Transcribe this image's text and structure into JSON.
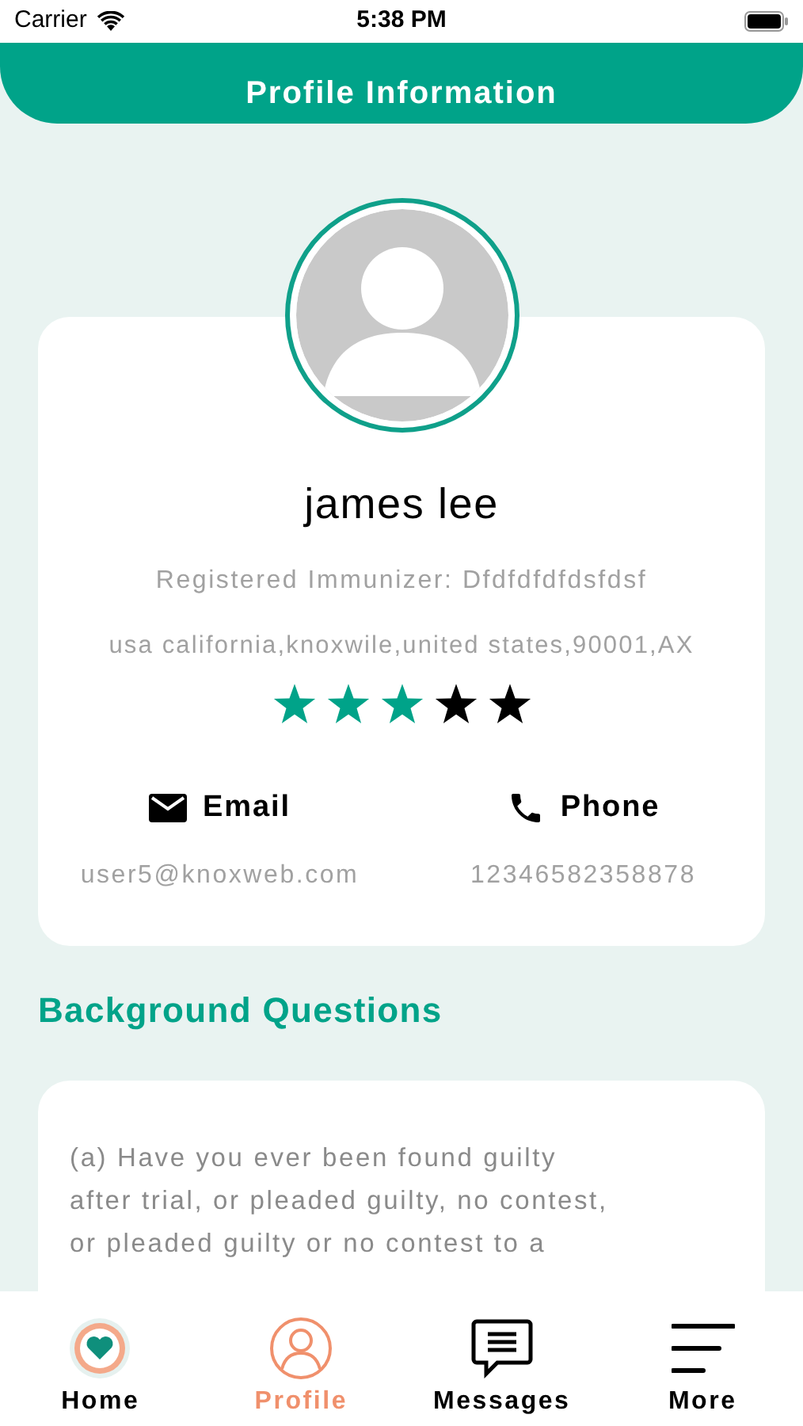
{
  "status_bar": {
    "carrier": "Carrier",
    "time": "5:38 PM"
  },
  "header": {
    "title": "Profile Information"
  },
  "profile": {
    "name": "james lee",
    "role": "Registered Immunizer: Dfdfdfdfdsfdsf",
    "address": "usa california,knoxwile,united states,90001,AX",
    "stars": 3,
    "contacts": [
      {
        "kind": "email",
        "label": "Email",
        "value": "user5@knoxweb.com"
      },
      {
        "kind": "phone",
        "label": "Phone",
        "value": "12346582358878"
      }
    ]
  },
  "background": {
    "title": "Background Questions",
    "questions": [
      "(a) Have you ever been found guilty\nafter trial, or pleaded guilty, no contest,\nor pleaded guilty or no contest to a"
    ]
  },
  "tab_bar": [
    {
      "kind": "home",
      "label": "Home",
      "selected": false
    },
    {
      "kind": "profile",
      "label": "Profile",
      "selected": true
    },
    {
      "kind": "messages",
      "label": "Messages",
      "selected": false
    },
    {
      "kind": "more",
      "label": "More",
      "selected": false
    }
  ]
}
